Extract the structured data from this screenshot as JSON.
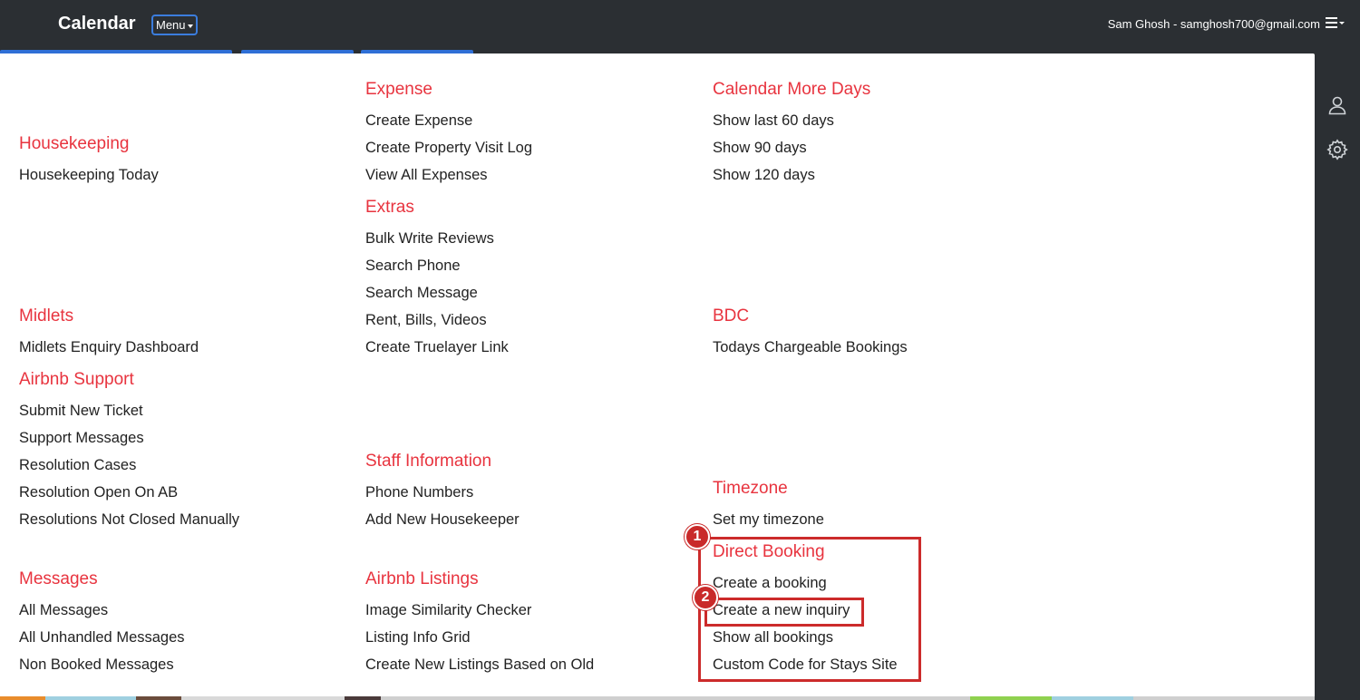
{
  "header": {
    "brand": "Calendar",
    "menu_label": "Menu",
    "user_label": "Sam Ghosh - samghosh700@gmail.com"
  },
  "icons": {
    "hamburger": "hamburger-menu-icon",
    "user": "user-icon",
    "settings": "gear-icon"
  },
  "colors": {
    "section_heading": "#e8343f",
    "topbar": "#2b2f33",
    "annotation": "#cc2b2b",
    "tab_accent": "#2f6fd6"
  },
  "menu": {
    "housekeeping": {
      "title": "Housekeeping",
      "items": [
        "Housekeeping Today"
      ]
    },
    "midlets": {
      "title": "Midlets",
      "items": [
        "Midlets Enquiry Dashboard"
      ]
    },
    "airbnb_support": {
      "title": "Airbnb Support",
      "items": [
        "Submit New Ticket",
        "Support Messages",
        "Resolution Cases",
        "Resolution Open On AB",
        "Resolutions Not Closed Manually"
      ]
    },
    "messages": {
      "title": "Messages",
      "items": [
        "All Messages",
        "All Unhandled Messages",
        "Non Booked Messages"
      ]
    },
    "expense": {
      "title": "Expense",
      "items": [
        "Create Expense",
        "Create Property Visit Log",
        "View All Expenses"
      ]
    },
    "extras": {
      "title": "Extras",
      "items": [
        "Bulk Write Reviews",
        "Search Phone",
        "Search Message",
        "Rent, Bills, Videos",
        "Create Truelayer Link"
      ]
    },
    "staff_information": {
      "title": "Staff Information",
      "items": [
        "Phone Numbers",
        "Add New Housekeeper"
      ]
    },
    "airbnb_listings": {
      "title": "Airbnb Listings",
      "items": [
        "Image Similarity Checker",
        "Listing Info Grid",
        "Create New Listings Based on Old"
      ]
    },
    "calendar_more_days": {
      "title": "Calendar More Days",
      "items": [
        "Show last 60 days",
        "Show 90 days",
        "Show 120 days"
      ]
    },
    "bdc": {
      "title": "BDC",
      "items": [
        "Todays Chargeable Bookings"
      ]
    },
    "timezone": {
      "title": "Timezone",
      "items": [
        "Set my timezone"
      ]
    },
    "direct_booking": {
      "title": "Direct Booking",
      "items": [
        "Create a booking",
        "Create a new inquiry",
        "Show all bookings",
        "Custom Code for Stays Site"
      ]
    }
  },
  "annotations": {
    "badge_1": "1",
    "badge_2": "2"
  }
}
